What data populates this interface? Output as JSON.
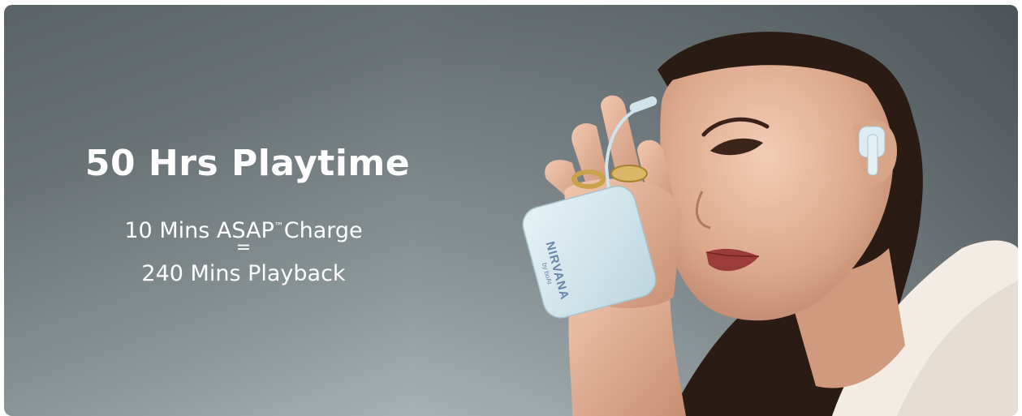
{
  "hero": {
    "headline": "50 Hrs Playtime",
    "charge_prefix": "10 Mins ASAP",
    "charge_tm": "™",
    "charge_suffix": "Charge",
    "equals": "=",
    "playback": "240 Mins Playback",
    "case_brand": "NIRVANA",
    "case_sub": "by boAt"
  },
  "colors": {
    "case": "#d6e9ef",
    "case_text": "#6a86a8",
    "text": "#ffffff"
  }
}
